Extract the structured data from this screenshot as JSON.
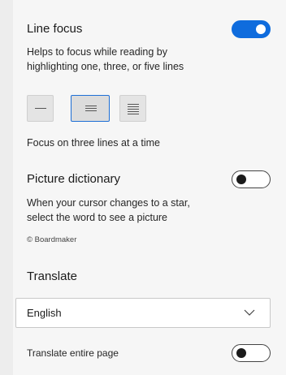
{
  "line_focus": {
    "title": "Line focus",
    "enabled": true,
    "description_line1": "Helps to focus while reading by",
    "description_line2": "highlighting one, three, or five lines",
    "options": [
      "one-line",
      "three-lines",
      "five-lines"
    ],
    "selected_option": "three-lines",
    "status": "Focus on three lines at a time"
  },
  "picture_dictionary": {
    "title": "Picture dictionary",
    "enabled": false,
    "description_line1": "When your cursor changes to a star,",
    "description_line2": "select the word to see a picture",
    "credit": "© Boardmaker"
  },
  "translate": {
    "title": "Translate",
    "language": "English",
    "entire_page_label": "Translate entire page",
    "entire_page_enabled": false
  },
  "colors": {
    "accent": "#0f6cdd",
    "panel_background": "#f6f6f6"
  }
}
